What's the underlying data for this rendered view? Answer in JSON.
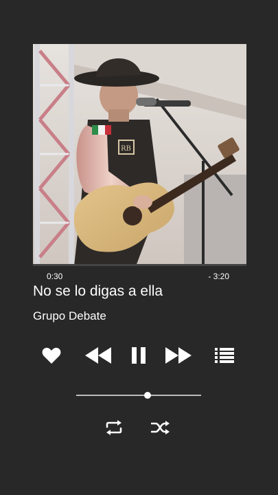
{
  "player": {
    "track_title": "No se lo digas a ella",
    "artist": "Grupo Debate",
    "elapsed": "0:30",
    "remaining": "- 3:20",
    "progress_fraction": 0.0,
    "volume_fraction": 0.57,
    "is_playing": true
  },
  "controls": {
    "like_icon": "heart-icon",
    "previous_icon": "rewind-icon",
    "pause_icon": "pause-icon",
    "next_icon": "fast-forward-icon",
    "queue_icon": "list-icon",
    "repeat_icon": "repeat-icon",
    "shuffle_icon": "shuffle-icon"
  },
  "colors": {
    "background": "#282828",
    "foreground": "#ffffff",
    "track": "#bdbdbd"
  }
}
